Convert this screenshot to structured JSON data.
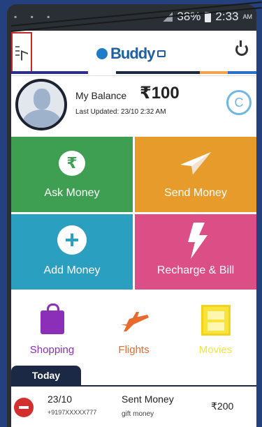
{
  "status_bar": {
    "battery": "38%",
    "time": "2:33",
    "ampm": "AM"
  },
  "header": {
    "logo_text": "Buddy",
    "colors": {
      "brand": "#1f5fa3",
      "accent_bar": [
        "#2b2f86",
        "#ffffff",
        "#1b2945",
        "#f2a24b",
        "#2a72c9"
      ]
    }
  },
  "balance": {
    "label": "My Balance",
    "amount": "₹100",
    "last_updated": "Last Updated: 23/10 2:32 AM"
  },
  "tiles": [
    {
      "label": "Ask Money",
      "color": "#3e9f53",
      "icon": "rupee-chat-icon"
    },
    {
      "label": "Send Money",
      "color": "#e79b2b",
      "icon": "paper-plane-icon"
    },
    {
      "label": "Add Money",
      "color": "#2a9fbf",
      "icon": "plus-icon"
    },
    {
      "label": "Recharge & Bill",
      "color": "#db4f86",
      "icon": "bolt-icon"
    }
  ],
  "categories": [
    {
      "label": "Shopping",
      "color": "#8b2fb8",
      "icon": "shopping-bag-icon"
    },
    {
      "label": "Flights",
      "color": "#e86a2c",
      "icon": "airplane-icon"
    },
    {
      "label": "Movies",
      "color": "#f3e24a",
      "icon": "film-icon"
    }
  ],
  "transactions": {
    "tab": "Today",
    "items": [
      {
        "date": "23/10",
        "phone": "+9197XXXXX777",
        "type": "Sent Money",
        "note": "gift money",
        "amount": "₹200"
      }
    ]
  }
}
